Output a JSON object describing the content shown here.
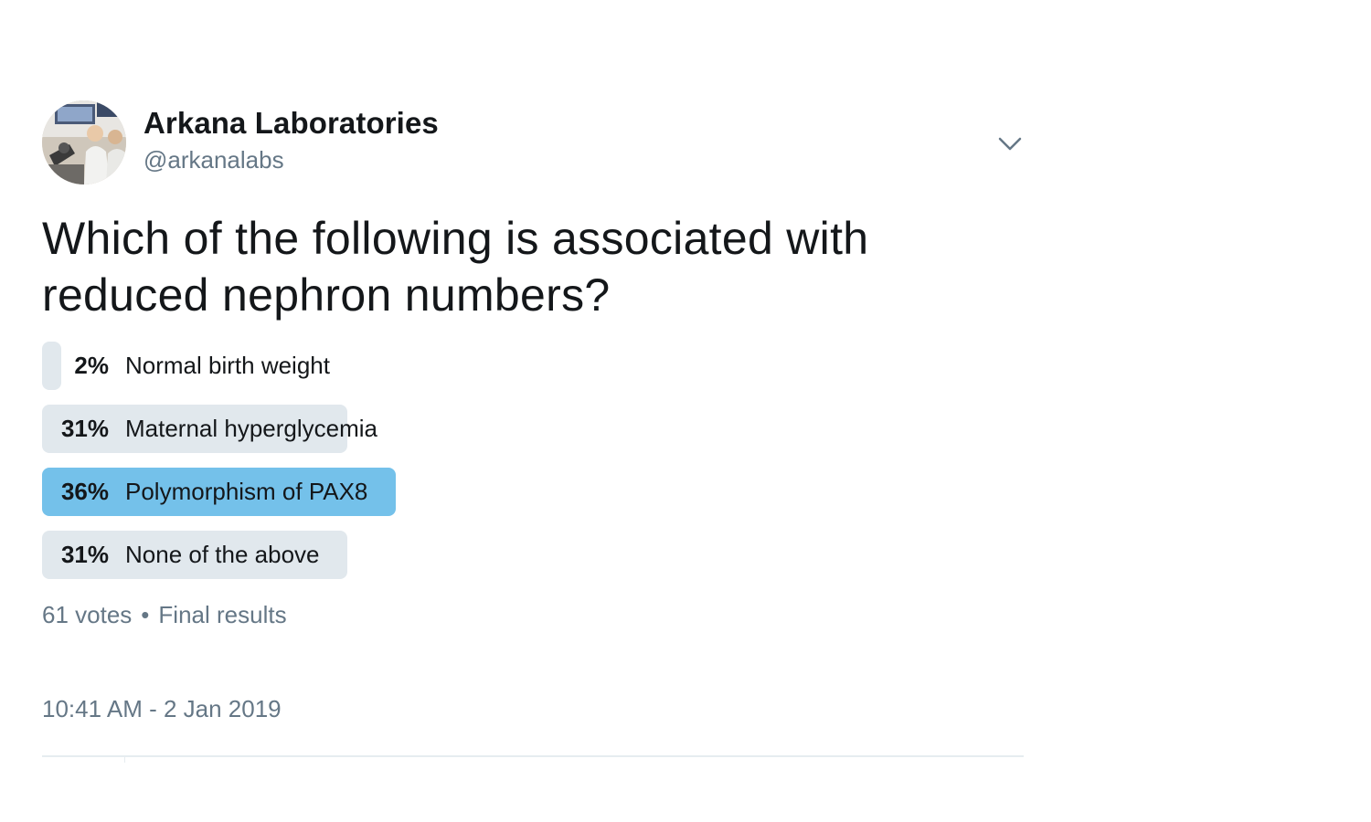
{
  "tweet": {
    "author": {
      "name": "Arkana Laboratories",
      "handle": "@arkanalabs",
      "avatar_icon": "lab-photo-avatar"
    },
    "menu_icon": "chevron-down-icon",
    "text_line1": "Which of the following is associated with",
    "text_line2": "reduced nephron numbers?",
    "poll": {
      "choices": [
        {
          "percent_label": "2%",
          "percent": 2,
          "label": "Normal birth weight",
          "winner": false
        },
        {
          "percent_label": "31%",
          "percent": 31,
          "label": "Maternal hyperglycemia",
          "winner": false
        },
        {
          "percent_label": "36%",
          "percent": 36,
          "label": "Polymorphism of PAX8",
          "winner": true
        },
        {
          "percent_label": "31%",
          "percent": 31,
          "label": "None of the above",
          "winner": false
        }
      ],
      "votes": "61 votes",
      "separator": "•",
      "status": "Final results"
    },
    "timestamp": "10:41 AM - 2 Jan 2019",
    "colors": {
      "bar": "#e1e8ed",
      "winner_bar": "#74c1ea",
      "secondary_text": "#657786"
    }
  }
}
